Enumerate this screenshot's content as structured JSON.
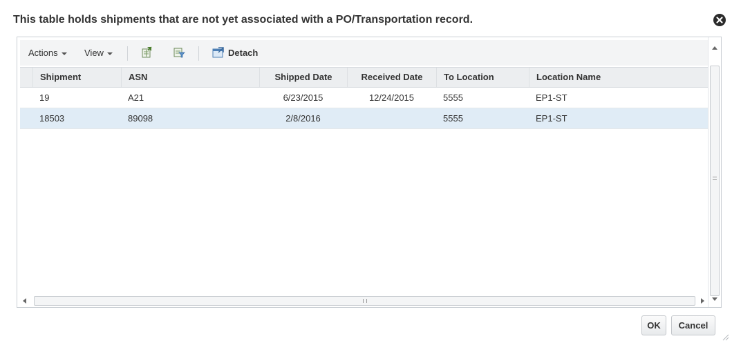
{
  "dialog": {
    "title": "This table holds shipments that are not yet associated with a PO/Transportation record.",
    "close_icon": "close-circle-icon"
  },
  "toolbar": {
    "actions_label": "Actions",
    "view_label": "View",
    "export_icon": "export-to-excel-icon",
    "filter_icon": "query-by-example-icon",
    "detach_icon": "detach-icon",
    "detach_label": "Detach"
  },
  "table": {
    "columns": [
      "Shipment",
      "ASN",
      "Shipped Date",
      "Received Date",
      "To Location",
      "Location Name"
    ],
    "rows": [
      {
        "shipment": "19",
        "asn": "A21",
        "shipped_date": "6/23/2015",
        "received_date": "12/24/2015",
        "to_location": "5555",
        "location_name": "EP1-ST",
        "selected": false
      },
      {
        "shipment": "18503",
        "asn": "89098",
        "shipped_date": "2/8/2016",
        "received_date": "",
        "to_location": "5555",
        "location_name": "EP1-ST",
        "selected": true
      }
    ]
  },
  "footer": {
    "ok_label": "OK",
    "cancel_label": "Cancel"
  },
  "colors": {
    "selected_row": "#e0ecf6",
    "header_bg": "#eceef0",
    "toolbar_bg": "#f3f4f5"
  }
}
